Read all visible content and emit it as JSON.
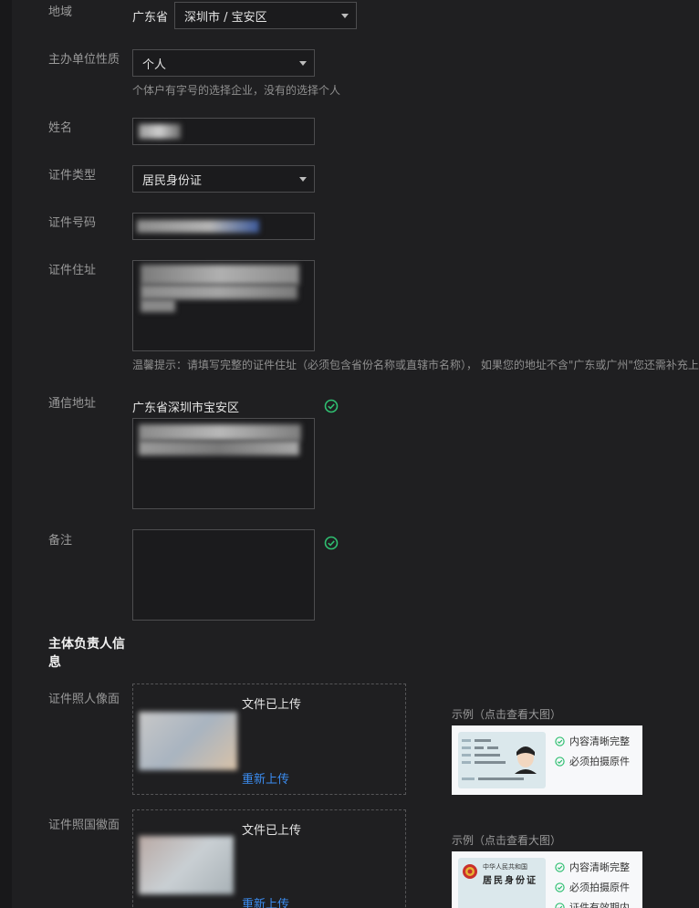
{
  "form": {
    "region": {
      "label": "地域",
      "province": "广东省",
      "city_value": "深圳市 / 宝安区"
    },
    "org_type": {
      "label": "主办单位性质",
      "value": "个人",
      "hint": "个体户有字号的选择企业，没有的选择个人"
    },
    "name": {
      "label": "姓名"
    },
    "id_type": {
      "label": "证件类型",
      "value": "居民身份证"
    },
    "id_number": {
      "label": "证件号码"
    },
    "id_address": {
      "label": "证件住址",
      "hint": "温馨提示：请填写完整的证件住址（必须包含省份名称或直辖市名称）， 如果您的地址不含\"广东或广州\"您还需补充上"
    },
    "mail_address": {
      "label": "通信地址",
      "prefix": "广东省深圳市宝安区"
    },
    "remark": {
      "label": "备注"
    }
  },
  "section": {
    "title": "主体负责人信息"
  },
  "uploads": [
    {
      "label": "证件照人像面",
      "status": "文件已上传",
      "reupload": "重新上传",
      "example_label": "示例（点击查看大图）",
      "checks": [
        "内容清晰完整",
        "必须拍摄原件"
      ]
    },
    {
      "label": "证件照国徽面",
      "status": "文件已上传",
      "reupload": "重新上传",
      "example_label": "示例（点击查看大图）",
      "checks": [
        "内容清晰完整",
        "必须拍摄原件",
        "证件有效期内"
      ]
    }
  ],
  "example_card_text": {
    "emblem_line1": "中华人民共和国",
    "emblem_line2": "居民身份证"
  },
  "colors": {
    "background": "#1f1f21",
    "link": "#3b8cf0",
    "success": "#2fbf71"
  }
}
